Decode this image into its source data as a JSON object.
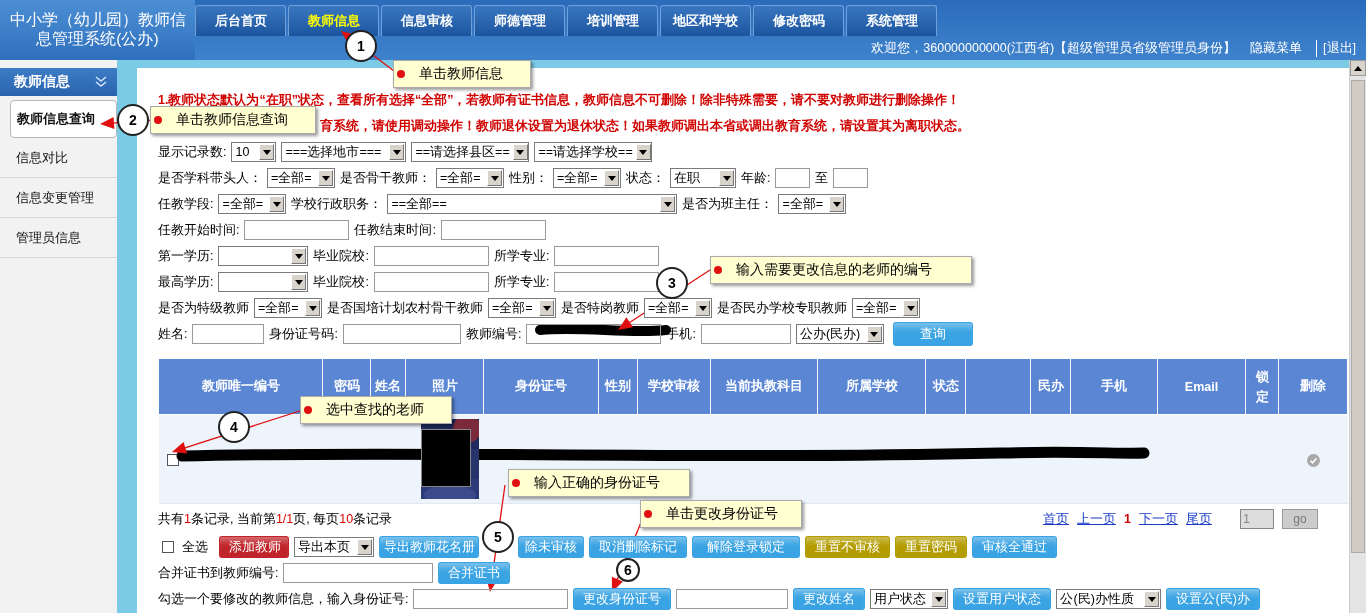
{
  "header": {
    "title": "中小学（幼儿园）教师信息管理系统(公办)",
    "tabs": [
      {
        "label": "后台首页",
        "selected": false
      },
      {
        "label": "教师信息",
        "selected": true
      },
      {
        "label": "信息审核",
        "selected": false
      },
      {
        "label": "师德管理",
        "selected": false
      },
      {
        "label": "培训管理",
        "selected": false
      },
      {
        "label": "地区和学校",
        "selected": false
      },
      {
        "label": "修改密码",
        "selected": false
      },
      {
        "label": "系统管理",
        "selected": false
      }
    ],
    "welcome": "欢迎您，360000000000(江西省)【超级管理员省级管理员身份】",
    "links": [
      "隐藏菜单",
      "[退出]"
    ]
  },
  "sidebar": {
    "title": "教师信息",
    "items": [
      {
        "label": "教师信息查询",
        "selected": true
      },
      {
        "label": "信息对比",
        "selected": false
      },
      {
        "label": "信息变更管理",
        "selected": false
      },
      {
        "label": "管理员信息",
        "selected": false
      }
    ]
  },
  "notices": [
    "1.教师状态默认为“在职”状态，查看所有选择“全部”，若教师有证书信息，教师信息不可删除！除非特殊需要，请不要对教师进行删除操作！",
    "育系统，请使用调动操作！教师退休设置为退休状态！如果教师调出本省或调出教育系统，请设置其为离职状态。"
  ],
  "filters": [
    [
      {
        "kind": "label",
        "text": "显示记录数:"
      },
      {
        "kind": "select",
        "value": "10"
      },
      {
        "kind": "select",
        "value": "===选择地市==="
      },
      {
        "kind": "select",
        "value": "==请选择县区=="
      },
      {
        "kind": "select",
        "value": "==请选择学校=="
      }
    ],
    [
      {
        "kind": "label",
        "text": "是否学科带头人："
      },
      {
        "kind": "select",
        "value": "=全部="
      },
      {
        "kind": "label",
        "text": "是否骨干教师："
      },
      {
        "kind": "select",
        "value": "=全部="
      },
      {
        "kind": "label",
        "text": "性别："
      },
      {
        "kind": "select",
        "value": "=全部="
      },
      {
        "kind": "label",
        "text": "状态："
      },
      {
        "kind": "select",
        "value": "在职"
      },
      {
        "kind": "label",
        "text": "年龄:"
      },
      {
        "kind": "input"
      },
      {
        "kind": "label",
        "text": "至"
      },
      {
        "kind": "input"
      }
    ],
    [
      {
        "kind": "label",
        "text": "任教学段:"
      },
      {
        "kind": "select",
        "value": "=全部="
      },
      {
        "kind": "label",
        "text": "学校行政职务："
      },
      {
        "kind": "select",
        "value": "==全部=="
      },
      {
        "kind": "label",
        "text": "是否为班主任："
      },
      {
        "kind": "select",
        "value": "=全部="
      }
    ],
    [
      {
        "kind": "label",
        "text": "任教开始时间:"
      },
      {
        "kind": "input"
      },
      {
        "kind": "label",
        "text": "任教结束时间:"
      },
      {
        "kind": "input"
      }
    ],
    [
      {
        "kind": "label",
        "text": "第一学历:"
      },
      {
        "kind": "select"
      },
      {
        "kind": "label",
        "text": "毕业院校:"
      },
      {
        "kind": "input"
      },
      {
        "kind": "label",
        "text": "所学专业:"
      },
      {
        "kind": "input"
      }
    ],
    [
      {
        "kind": "label",
        "text": "最高学历:"
      },
      {
        "kind": "select"
      },
      {
        "kind": "label",
        "text": "毕业院校:"
      },
      {
        "kind": "input"
      },
      {
        "kind": "label",
        "text": "所学专业:"
      },
      {
        "kind": "input"
      }
    ],
    [
      {
        "kind": "label",
        "text": "是否为特级教师"
      },
      {
        "kind": "select",
        "value": "=全部="
      },
      {
        "kind": "label",
        "text": "是否国培计划农村骨干教师"
      },
      {
        "kind": "select",
        "value": "=全部="
      },
      {
        "kind": "label",
        "text": "是否特岗教师"
      },
      {
        "kind": "select",
        "value": "=全部="
      },
      {
        "kind": "label",
        "text": "是否民办学校专职教师"
      },
      {
        "kind": "select",
        "value": "=全部="
      }
    ],
    [
      {
        "kind": "label",
        "text": "姓名:"
      },
      {
        "kind": "input"
      },
      {
        "kind": "label",
        "text": "身份证号码:"
      },
      {
        "kind": "input"
      },
      {
        "kind": "label",
        "text": "教师编号:"
      },
      {
        "kind": "input"
      },
      {
        "kind": "label",
        "text": "手机:"
      },
      {
        "kind": "input"
      },
      {
        "kind": "select",
        "value": "公办(民办)"
      },
      {
        "kind": "button",
        "label": "查询",
        "color": "#3aa3e3"
      }
    ]
  ],
  "table": {
    "columns": [
      {
        "label": "教师唯一编号"
      },
      {
        "label": "密码"
      },
      {
        "label": "姓名"
      },
      {
        "label": "照片"
      },
      {
        "label": "身份证号"
      },
      {
        "label": "性别"
      },
      {
        "label": "学校审核"
      },
      {
        "label": "当前执教科目"
      },
      {
        "label": "所属学校"
      },
      {
        "label": "状态"
      },
      {},
      {
        "label": "民办"
      },
      {
        "label": "手机"
      },
      {
        "label": "Email"
      },
      {
        "label": "锁定"
      },
      {
        "label": "删除"
      }
    ],
    "rows": [
      {
        "checked": false
      }
    ]
  },
  "summary": [
    {
      "text": "共有",
      "highlight": false
    },
    {
      "text": "1",
      "highlight": true
    },
    {
      "text": "条记录, 当前第",
      "highlight": false
    },
    {
      "text": "1/1",
      "highlight": true
    },
    {
      "text": "页, 每页",
      "highlight": false
    },
    {
      "text": "10",
      "highlight": true
    },
    {
      "text": "条记录",
      "highlight": false
    }
  ],
  "pagination": {
    "links": [
      {
        "label": "首页",
        "selected": false
      },
      {
        "label": "上一页",
        "selected": false
      },
      {
        "label": "1",
        "selected": true
      },
      {
        "label": "下一页",
        "selected": false
      },
      {
        "label": "尾页",
        "selected": false
      }
    ],
    "page": "1",
    "go": "go",
    "disabled": true
  },
  "actions": [
    [
      {
        "kind": "checkbox",
        "label": "全选",
        "checked": false
      },
      {
        "kind": "button",
        "label": "添加教师",
        "color": "#c0242a"
      },
      {
        "kind": "select",
        "value": "导出本页"
      },
      {
        "kind": "button",
        "label": "导出教师花名册",
        "color": "#3aa3e3"
      },
      {
        "kind": "button",
        "label": "除未审核",
        "color": "#3aa3e3"
      },
      {
        "kind": "button",
        "label": "取消删除标记",
        "color": "#3aa3e3"
      },
      {
        "kind": "button",
        "label": "解除登录锁定",
        "color": "#3aa3e3"
      },
      {
        "kind": "button",
        "label": "重置不审核",
        "color": "#b39c00"
      },
      {
        "kind": "button",
        "label": "重置密码",
        "color": "#b39c00"
      },
      {
        "kind": "button",
        "label": "审核全通过",
        "color": "#3aa3e3"
      }
    ],
    [
      {
        "kind": "label",
        "text": "合并证书到教师编号:"
      },
      {
        "kind": "input"
      },
      {
        "kind": "button",
        "label": "合并证书",
        "color": "#3aa3e3"
      }
    ],
    [
      {
        "kind": "label",
        "text": "勾选一个要修改的教师信息，输入身份证号:"
      },
      {
        "kind": "input"
      },
      {
        "kind": "button",
        "label": "更改身份证号",
        "color": "#3aa3e3"
      },
      {
        "kind": "input"
      },
      {
        "kind": "button",
        "label": "更改姓名",
        "color": "#3aa3e3"
      },
      {
        "kind": "select",
        "value": "用户状态"
      },
      {
        "kind": "button",
        "label": "设置用户状态",
        "color": "#3aa3e3"
      },
      {
        "kind": "select",
        "value": "公(民)办性质"
      },
      {
        "kind": "button",
        "label": "设置公(民)办",
        "color": "#3aa3e3"
      }
    ]
  ],
  "callouts": [
    {
      "number": "1",
      "text": "单击教师信息"
    },
    {
      "number": "2",
      "text": "单击教师信息查询"
    },
    {
      "number": "3",
      "text": "输入需要更改信息的老师的编号"
    },
    {
      "number": "4",
      "text": "选中查找的老师"
    },
    {
      "number": "5",
      "text": "输入正确的身份证号"
    },
    {
      "number": "6",
      "text": "单击更改身份证号"
    }
  ]
}
